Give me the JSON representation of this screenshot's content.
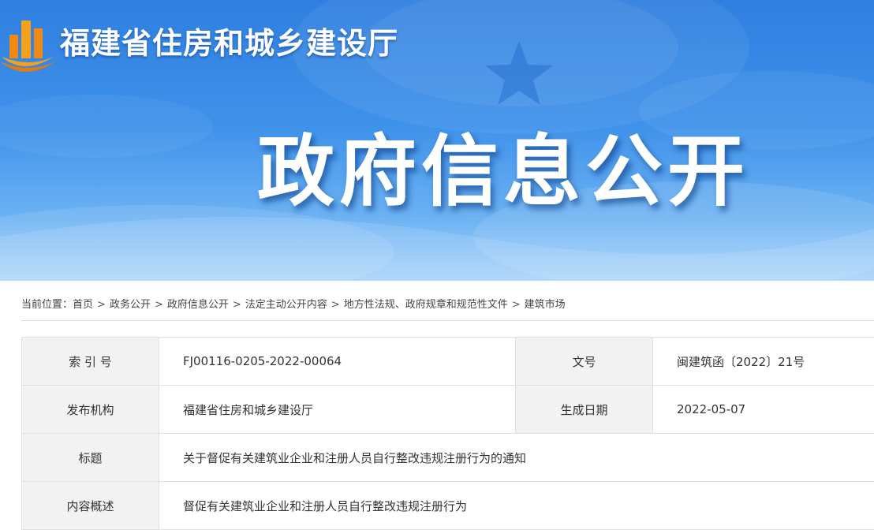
{
  "header": {
    "site_name": "福建省住房和城乡建设厅",
    "banner_title": "政府信息公开",
    "logo_icon": "building-logo-icon",
    "colors": {
      "banner_top": "#2f7fe0",
      "banner_bottom": "#a9d3fa",
      "logo_orange": "#f08a14"
    }
  },
  "breadcrumb": {
    "prefix": "当前位置：",
    "separator": ">",
    "items": [
      "首页",
      "政务公开",
      "政府信息公开",
      "法定主动公开内容",
      "地方性法规、政府规章和规范性文件",
      "建筑市场"
    ]
  },
  "info": {
    "index_label": "索 引 号",
    "index_value": "FJ00116-0205-2022-00064",
    "doc_no_label": "文号",
    "doc_no_value": "闽建筑函〔2022〕21号",
    "publisher_label": "发布机构",
    "publisher_value": "福建省住房和城乡建设厅",
    "date_label": "生成日期",
    "date_value": "2022-05-07",
    "title_label": "标题",
    "title_value": "关于督促有关建筑业企业和注册人员自行整改违规注册行为的通知",
    "summary_label": "内容概述",
    "summary_value": "督促有关建筑业企业和注册人员自行整改违规注册行为"
  }
}
